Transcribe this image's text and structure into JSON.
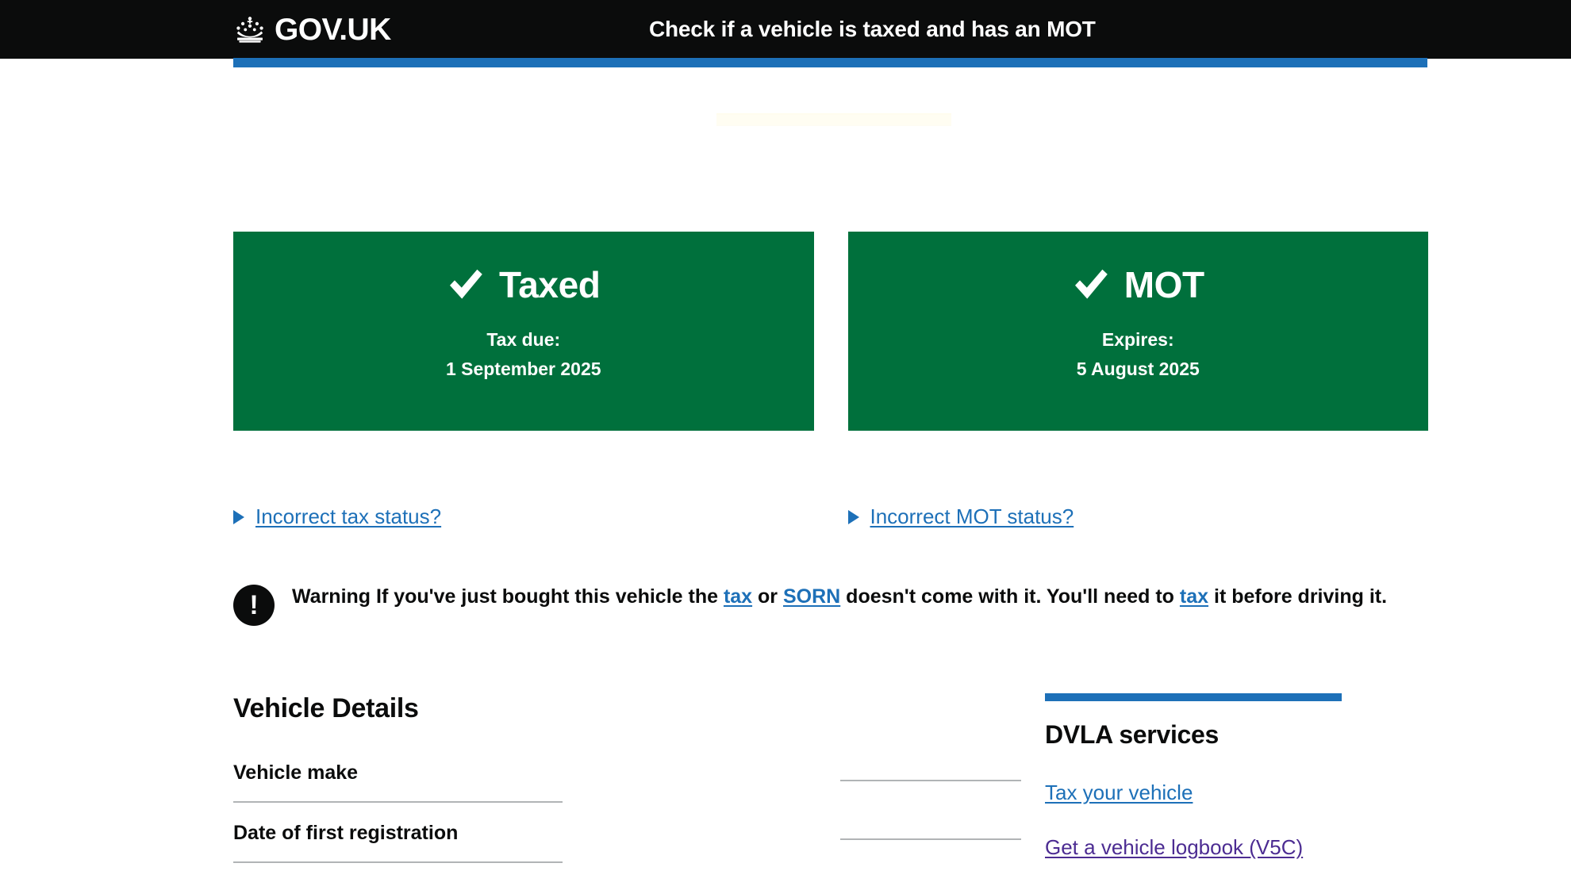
{
  "header": {
    "brand": "GOV.UK",
    "crown_icon": "crown-icon",
    "service_title": "Check if a vehicle is taxed and has an MOT"
  },
  "status": {
    "tax": {
      "icon": "tick-icon",
      "label": "Taxed",
      "sub_label": "Tax due:",
      "date": "1 September 2025",
      "link": "Incorrect tax status?",
      "disclosure_icon": "triangle-right-icon"
    },
    "mot": {
      "icon": "tick-icon",
      "label": "MOT",
      "sub_label": "Expires:",
      "date": "5 August 2025",
      "link": "Incorrect MOT status?",
      "disclosure_icon": "triangle-right-icon"
    }
  },
  "warning": {
    "icon": "warning-exclamation-icon",
    "icon_glyph": "!",
    "prefix": "Warning",
    "text_1": " If you've just bought this vehicle the ",
    "link_1": "tax",
    "text_2": " or ",
    "link_2": "SORN",
    "text_3": " doesn't come with it. You'll need to ",
    "link_3": "tax",
    "text_4": " it before driving it."
  },
  "vehicle_details": {
    "title": "Vehicle Details",
    "rows": [
      {
        "key": "Vehicle make",
        "value": ""
      },
      {
        "key": "Date of first registration",
        "value": ""
      }
    ]
  },
  "aside": {
    "title": "DVLA services",
    "links": [
      {
        "label": "Tax your vehicle",
        "state": "unvisited"
      },
      {
        "label": "Get a vehicle logbook (V5C)",
        "state": "visited"
      }
    ]
  },
  "colors": {
    "black": "#0b0c0c",
    "green": "#00703c",
    "blue": "#1d70b8",
    "visited_link": "#4c2c92",
    "rule_grey": "#b1b4b6"
  }
}
